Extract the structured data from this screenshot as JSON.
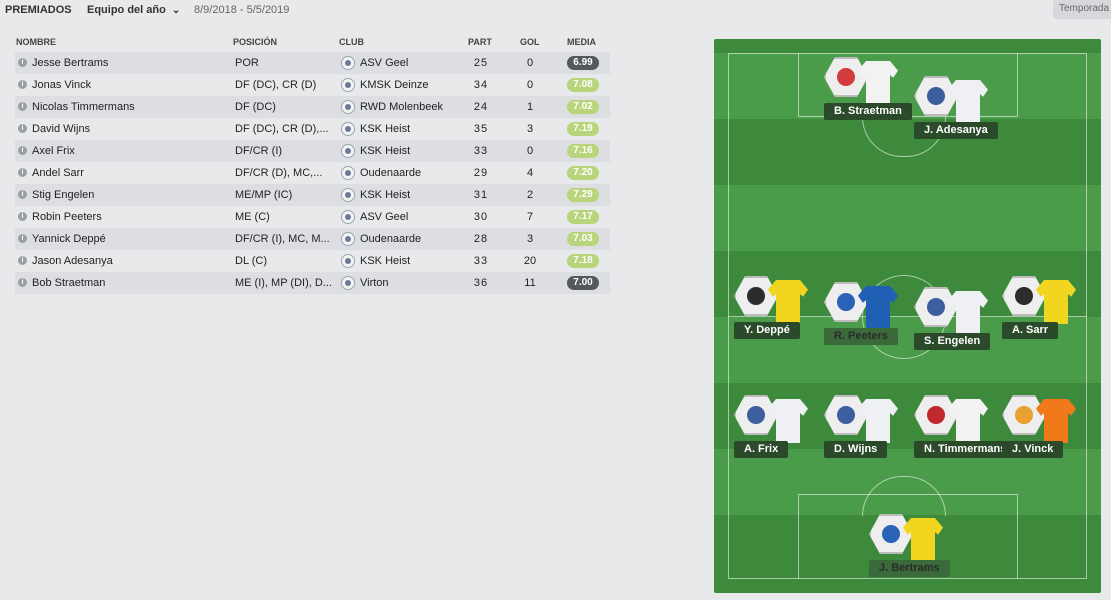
{
  "header": {
    "title": "PREMIADOS",
    "select_value": "Equipo del año",
    "dates": "8/9/2018 - 5/5/2019",
    "season_label": "Temporada"
  },
  "table": {
    "columns": {
      "name": "NOMBRE",
      "position": "POSICIÓN",
      "club": "CLUB",
      "part": "PART",
      "gol": "GOL",
      "media": "MEDIA"
    },
    "rows": [
      {
        "name": "Jesse Bertrams",
        "position": "POR",
        "club": "ASV Geel",
        "part": "25",
        "gol": "0",
        "media": "6.99"
      },
      {
        "name": "Jonas Vinck",
        "position": "DF (DC), CR (D)",
        "club": "KMSK Deinze",
        "part": "34",
        "gol": "0",
        "media": "7.08"
      },
      {
        "name": "Nicolas Timmermans",
        "position": "DF (DC)",
        "club": "RWD Molenbeek",
        "part": "24",
        "gol": "1",
        "media": "7.02"
      },
      {
        "name": "David Wijns",
        "position": "DF (DC), CR (D),...",
        "club": "KSK Heist",
        "part": "35",
        "gol": "3",
        "media": "7.19"
      },
      {
        "name": "Axel Frix",
        "position": "DF/CR (I)",
        "club": "KSK Heist",
        "part": "33",
        "gol": "0",
        "media": "7.16"
      },
      {
        "name": "Andel Sarr",
        "position": "DF/CR (D), MC,...",
        "club": "Oudenaarde",
        "part": "29",
        "gol": "4",
        "media": "7.20"
      },
      {
        "name": "Stig Engelen",
        "position": "ME/MP (IC)",
        "club": "KSK Heist",
        "part": "31",
        "gol": "2",
        "media": "7.29"
      },
      {
        "name": "Robin Peeters",
        "position": "ME (C)",
        "club": "ASV Geel",
        "part": "30",
        "gol": "7",
        "media": "7.17"
      },
      {
        "name": "Yannick Deppé",
        "position": "DF/CR (I), MC, M...",
        "club": "Oudenaarde",
        "part": "28",
        "gol": "3",
        "media": "7.03"
      },
      {
        "name": "Jason Adesanya",
        "position": "DL (C)",
        "club": "KSK Heist",
        "part": "33",
        "gol": "20",
        "media": "7.18"
      },
      {
        "name": "Bob Straetman",
        "position": "ME (I), MP (DI), D...",
        "club": "Virton",
        "part": "36",
        "gol": "11",
        "media": "7.00"
      }
    ]
  },
  "pitch": {
    "players": [
      {
        "label": "B. Straetman",
        "shirt": "#f2f2f2",
        "crest": "#d23c3c"
      },
      {
        "label": "J. Adesanya",
        "shirt": "#eef0f4",
        "crest": "#3d5fa0"
      },
      {
        "label": "Y. Deppé",
        "shirt": "#f1d51f",
        "crest": "#2c2c2c"
      },
      {
        "label": "R. Peeters",
        "shirt": "#1f5fb4",
        "crest": "#2a62b8"
      },
      {
        "label": "S. Engelen",
        "shirt": "#eef0f4",
        "crest": "#3d5fa0"
      },
      {
        "label": "A. Sarr",
        "shirt": "#f1d51f",
        "crest": "#2c2c2c"
      },
      {
        "label": "A. Frix",
        "shirt": "#eef0f4",
        "crest": "#3d5fa0"
      },
      {
        "label": "D. Wijns",
        "shirt": "#eef0f4",
        "crest": "#3d5fa0"
      },
      {
        "label": "N. Timmermans",
        "shirt": "#f2f2f2",
        "crest": "#c0282d"
      },
      {
        "label": "J. Vinck",
        "shirt": "#f07a1a",
        "crest": "#e8a030"
      },
      {
        "label": "J. Bertrams",
        "shirt": "#f1d51f",
        "crest": "#2a62b8"
      }
    ]
  }
}
